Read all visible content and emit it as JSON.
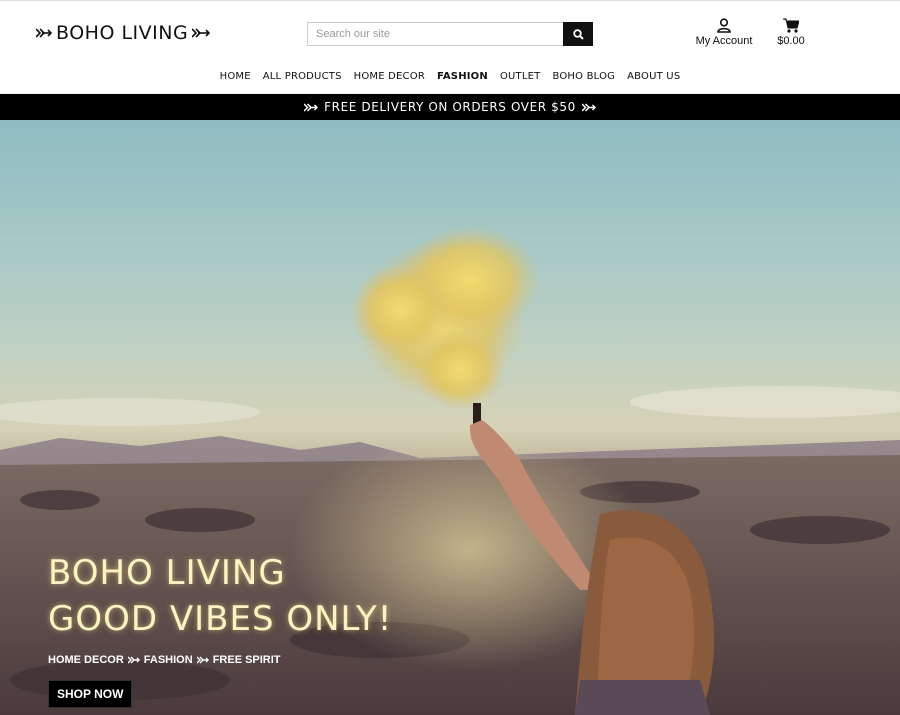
{
  "header": {
    "logo_text": "BOHO LIVING",
    "search_placeholder": "Search our site",
    "account_label": "My Account",
    "cart_total": "$0.00"
  },
  "nav": {
    "items": [
      "HOME",
      "ALL PRODUCTS",
      "HOME DECOR",
      "FASHION",
      "OUTLET",
      "BOHO BLOG",
      "ABOUT US"
    ],
    "active": "FASHION"
  },
  "promo": {
    "text": "FREE DELIVERY ON ORDERS OVER $50"
  },
  "hero": {
    "title_line1": "BOHO LIVING",
    "title_line2": "GOOD VIBES ONLY!",
    "subtitle_parts": [
      "HOME DECOR",
      "FASHION",
      "FREE SPIRIT"
    ],
    "cta_label": "SHOP NOW"
  },
  "colors": {
    "accent": "#000000",
    "hero_title": "#fbf3c4",
    "smoke": "#e8d06a"
  },
  "icons": [
    "arrow-icon",
    "search-icon",
    "user-icon",
    "cart-icon"
  ]
}
